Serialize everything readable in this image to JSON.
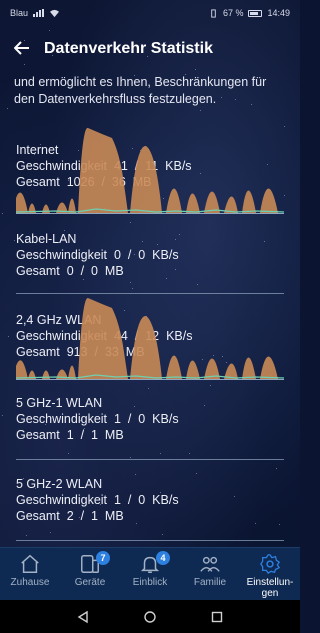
{
  "status_bar": {
    "carrier": "Blau",
    "battery": "67 %",
    "time": "14:49"
  },
  "header": {
    "title": "Datenverkehr Statistik"
  },
  "intro_text": [
    "und ermöglicht es Ihnen, Beschränkungen für",
    "den Datenverkehrsfluss festzulegen."
  ],
  "sections": [
    {
      "name": "Internet",
      "speed": "Geschwindigkeit  41  /  11  KB/s",
      "total": "Gesamt  1026  /  36  MB",
      "has_graph": true
    },
    {
      "name": "Kabel-LAN",
      "speed": "Geschwindigkeit  0  /  0  KB/s",
      "total": "Gesamt  0  /  0  MB",
      "has_graph": false
    },
    {
      "name": "2,4 GHz WLAN",
      "speed": "Geschwindigkeit  44  /  12  KB/s",
      "total": "Gesamt  913  /  33  MB",
      "has_graph": true
    },
    {
      "name": "5 GHz-1 WLAN",
      "speed": "Geschwindigkeit  1  /  0  KB/s",
      "total": "Gesamt  1  /  1  MB",
      "has_graph": false
    },
    {
      "name": "5 GHz-2 WLAN",
      "speed": "Geschwindigkeit  1  /  0  KB/s",
      "total": "Gesamt  2  /  1  MB",
      "has_graph": false
    }
  ],
  "bottom_nav": [
    {
      "label": "Zuhause",
      "icon": "home-icon",
      "badge": ""
    },
    {
      "label": "Geräte",
      "icon": "devices-icon",
      "badge": "7"
    },
    {
      "label": "Einblick",
      "icon": "bell-icon",
      "badge": "4"
    },
    {
      "label": "Familie",
      "icon": "family-icon",
      "badge": ""
    },
    {
      "label": "Einstellun-\ngen",
      "icon": "settings-icon",
      "badge": ""
    }
  ],
  "colors": {
    "graph_fill": "#c98a55",
    "graph_line": "#6fd0b0",
    "accent": "#2d7fe0",
    "nav_bg": "#0f2a52"
  }
}
